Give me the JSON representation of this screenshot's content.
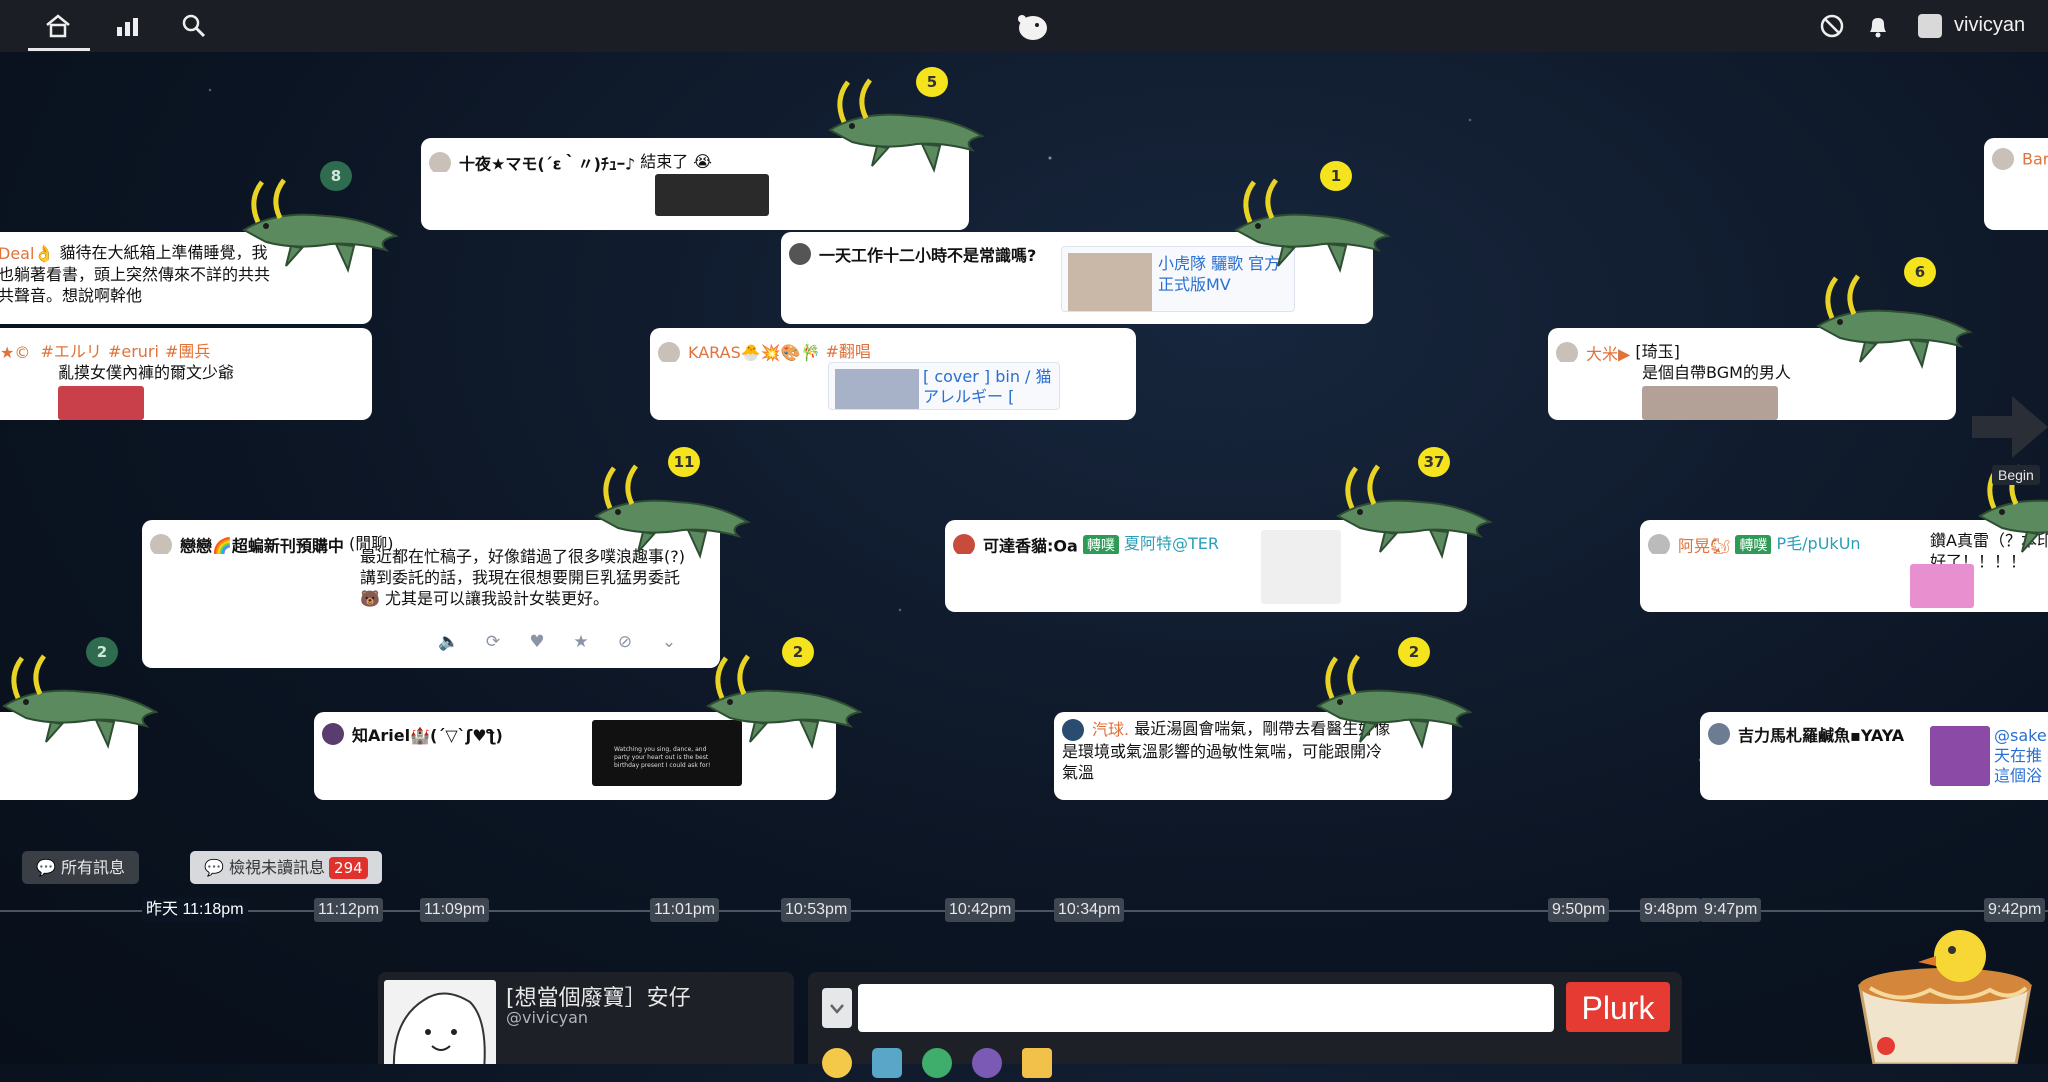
{
  "header": {
    "username": "vivicyan",
    "icons": [
      "home-icon",
      "stats-icon",
      "search-icon",
      "plurk-logo",
      "privacy-icon",
      "bell-icon"
    ]
  },
  "plurks": [
    {
      "id": "p1",
      "author": "十夜★マモ(´ε｀〃)ﾁｭｰ♪",
      "text": "結束了 😭",
      "count": "5"
    },
    {
      "id": "p2",
      "author": "Deal👌",
      "text": "貓待在大紙箱上準備睡覺，我也躺著看書，頭上突然傳來不詳的共共共聲音。想說啊幹他",
      "count": "8"
    },
    {
      "id": "p3",
      "author": "一天工作十二小時不是常識嗎?",
      "link": "小虎隊 驪歌 官方正式版MV",
      "count": "1"
    },
    {
      "id": "p4",
      "author": "KARAS🐣💥🎨🎋",
      "tag": "#翻唱",
      "link": "[ cover ] bin / 猫アレルギー [",
      "count": ""
    },
    {
      "id": "p5",
      "author": "大米▶",
      "text1": "[琦玉]",
      "text2": "是個自帶BGM的男人",
      "count": "6"
    },
    {
      "id": "p6",
      "author_prefix": "★©",
      "tags": [
        "#エルリ",
        "#eruri",
        "#團兵"
      ],
      "text": "亂摸女僕內褲的爾文少爺",
      "count": ""
    },
    {
      "id": "p7",
      "author": "戀戀🌈超蝙新刊預購中",
      "qualifier": "(閒聊)",
      "text": "最近都在忙稿子，好像錯過了很多噗浪趣事(?)講到委託的話，我現在很想要開巨乳猛男委託 🐻 尤其是可以讓我設計女裝更好。",
      "count": "11"
    },
    {
      "id": "p8",
      "author": "可達香貓:Oa",
      "replurk": "轉噗",
      "replurk_from": "夏阿特@TER",
      "count": "37"
    },
    {
      "id": "p9",
      "author": "阿晃🐿",
      "replurk": "轉噗",
      "replurk_from": "P毛/pUkUn",
      "text": "鑽A真雷（？本印好了！！！！",
      "count": ""
    },
    {
      "id": "p10",
      "author": "",
      "text": "",
      "count": "2"
    },
    {
      "id": "p11",
      "author": "知Ariel🏰(´▽`ʃ♥ƪ)",
      "thumb_caption": "Watching you sing, dance, and party your heart out is the best birthday present I could ask for!",
      "count": "2"
    },
    {
      "id": "p12",
      "author": "汽球.",
      "text": "最近湯圓會喘氣，剛帶去看醫生好像是環境或氣溫影響的過敏性氣喘，可能跟開冷氣溫",
      "count": "2"
    },
    {
      "id": "p13",
      "author": "吉力馬札羅鹹魚▪YAYA",
      "link": "@sake 天在推 這個浴",
      "count": ""
    },
    {
      "id": "p14",
      "author": "Bar",
      "count": ""
    }
  ],
  "filters": {
    "all_label": "所有訊息",
    "unread_label": "檢視未讀訊息",
    "unread_count": "294"
  },
  "timeline": {
    "now_label": "昨天 11:18pm",
    "ticks": [
      "11:12pm",
      "11:09pm",
      "11:01pm",
      "10:53pm",
      "10:42pm",
      "10:34pm",
      "9:50pm",
      "9:48pm",
      "9:47pm",
      "9:42pm"
    ]
  },
  "begin_label": "Begin",
  "composer": {
    "profile_title": "[想當個廢寶］安仔",
    "profile_handle": "@vivicyan",
    "input_placeholder": "",
    "plurk_button": "Plurk"
  },
  "colors": {
    "accent": "#e53b32",
    "timeline_bg": "#0b1422",
    "topbar": "#1b1e24",
    "croc": "#5a8a5e",
    "bubble_yellow": "#f4e31d"
  }
}
